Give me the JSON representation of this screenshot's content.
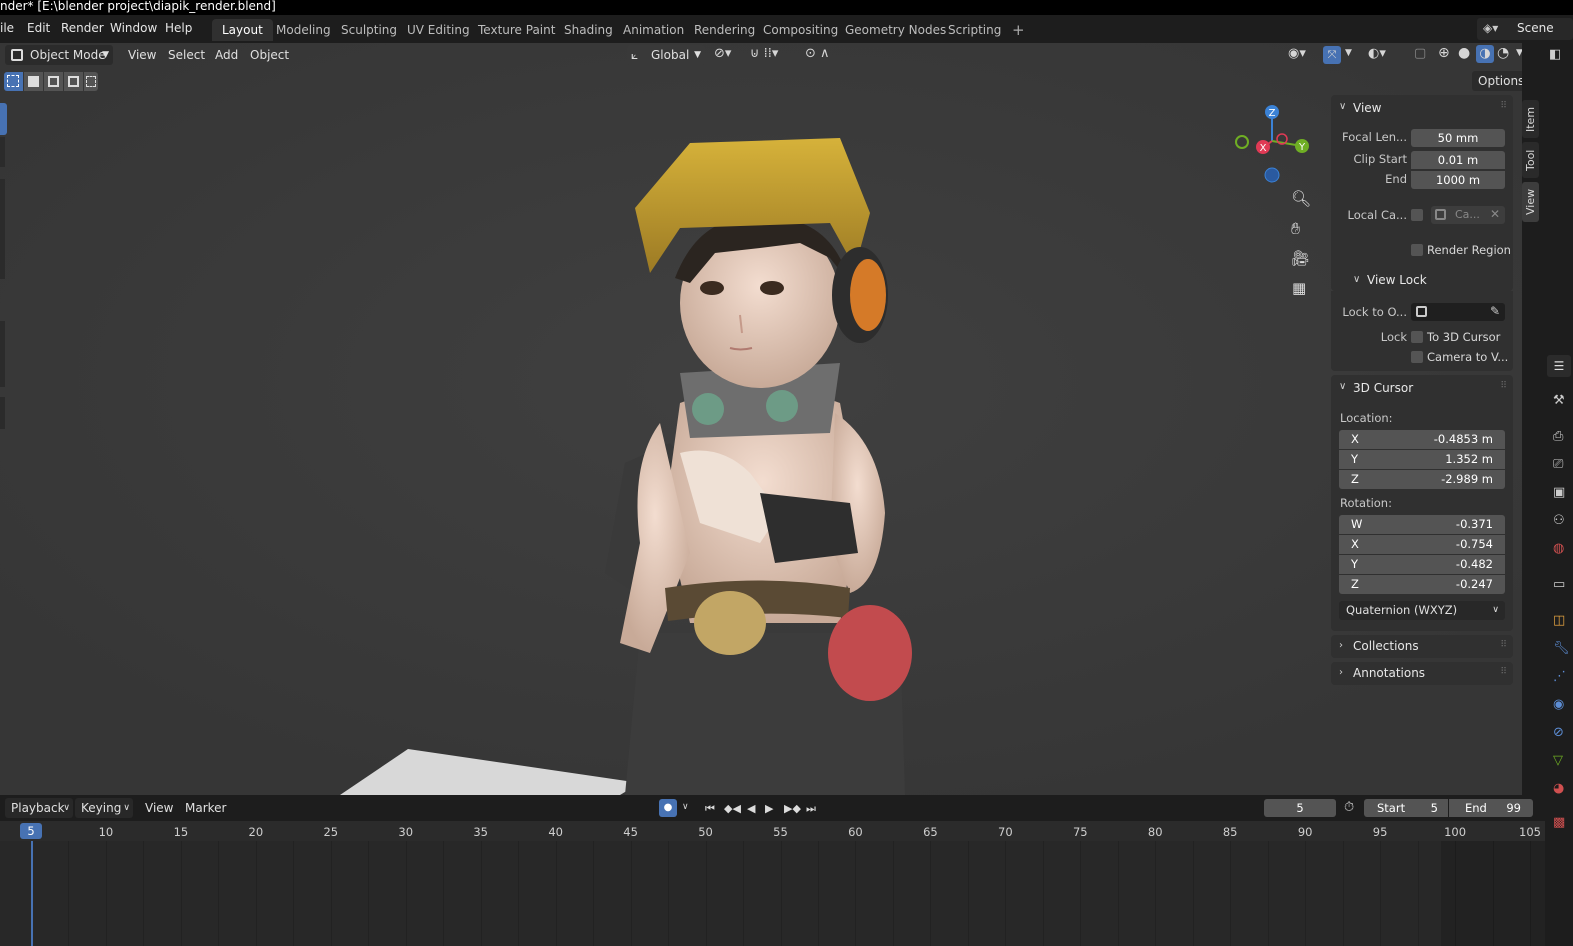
{
  "titlebar": {
    "text": "nder* [E:\\blender project\\diapik_render.blend]"
  },
  "menus": [
    "ile",
    "Edit",
    "Render",
    "Window",
    "Help"
  ],
  "workspaces": [
    {
      "label": "Layout",
      "active": true
    },
    {
      "label": "Modeling"
    },
    {
      "label": "Sculpting"
    },
    {
      "label": "UV Editing"
    },
    {
      "label": "Texture Paint"
    },
    {
      "label": "Shading"
    },
    {
      "label": "Animation"
    },
    {
      "label": "Rendering"
    },
    {
      "label": "Compositing"
    },
    {
      "label": "Geometry Nodes"
    },
    {
      "label": "Scripting"
    }
  ],
  "add_workspace": "+",
  "scene": {
    "label": "Scene"
  },
  "viewport_header": {
    "mode": "Object Mode",
    "menus": [
      "View",
      "Select",
      "Add",
      "Object"
    ],
    "transform_orientation": "Global",
    "options": "Options"
  },
  "gizmo": {
    "z": "Z",
    "x": "X",
    "y": "Y"
  },
  "npanel": {
    "view": {
      "title": "View",
      "focal_label": "Focal Len...",
      "focal_value": "50 mm",
      "clip_start_label": "Clip Start",
      "clip_start_value": "0.01 m",
      "end_label": "End",
      "end_value": "1000 m",
      "local_camera_label": "Local Ca...",
      "local_camera_value": "Ca...",
      "render_region": "Render Region"
    },
    "view_lock": {
      "title": "View Lock",
      "lock_to_label": "Lock to O...",
      "lock_label": "Lock",
      "to_cursor": "To 3D Cursor",
      "camera_to_view": "Camera to V..."
    },
    "cursor": {
      "title": "3D Cursor",
      "location_label": "Location:",
      "location": [
        {
          "axis": "X",
          "value": "-0.4853 m"
        },
        {
          "axis": "Y",
          "value": "1.352 m"
        },
        {
          "axis": "Z",
          "value": "-2.989 m"
        }
      ],
      "rotation_label": "Rotation:",
      "rotation": [
        {
          "axis": "W",
          "value": "-0.371"
        },
        {
          "axis": "X",
          "value": "-0.754"
        },
        {
          "axis": "Y",
          "value": "-0.482"
        },
        {
          "axis": "Z",
          "value": "-0.247"
        }
      ],
      "rotation_mode": "Quaternion (WXYZ)"
    },
    "collections": "Collections",
    "annotations": "Annotations"
  },
  "side_tabs": [
    "Item",
    "Tool",
    "View"
  ],
  "timeline": {
    "menus": [
      "Playback",
      "Keying",
      "View",
      "Marker"
    ],
    "current_frame": "5",
    "start_label": "Start",
    "start_value": "5",
    "end_label": "End",
    "end_value": "99",
    "playhead": "5",
    "ticks": [
      "10",
      "15",
      "20",
      "25",
      "30",
      "35",
      "40",
      "45",
      "50",
      "55",
      "60",
      "65",
      "70",
      "75",
      "80",
      "85",
      "90",
      "95",
      "100",
      "105"
    ]
  },
  "colors": {
    "accent": "#4772b3",
    "axis_x": "#e03a55",
    "axis_y": "#6fae24",
    "axis_z": "#3b82d6"
  }
}
